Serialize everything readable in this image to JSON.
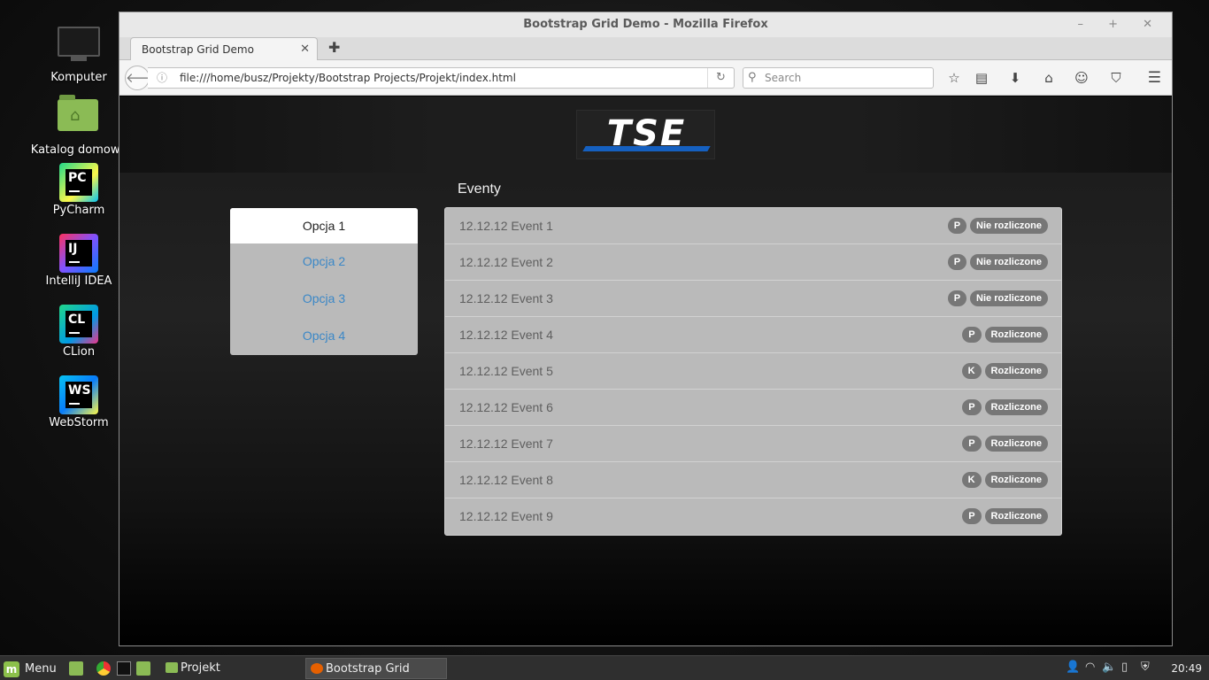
{
  "desktop": {
    "icons": [
      {
        "label": "Komputer"
      },
      {
        "label": "Katalog domowy"
      },
      {
        "label": "PyCharm",
        "abbr": "PC"
      },
      {
        "label": "IntelliJ IDEA",
        "abbr": "IJ"
      },
      {
        "label": "CLion",
        "abbr": "CL"
      },
      {
        "label": "WebStorm",
        "abbr": "WS"
      }
    ]
  },
  "window": {
    "title": "Bootstrap Grid Demo - Mozilla Firefox",
    "controls": "–  +  ✕",
    "tab": {
      "label": "Bootstrap Grid Demo",
      "close": "✕"
    },
    "newtab": "✚",
    "url": "file:///home/busz/Projekty/Bootstrap Projects/Projekt/index.html",
    "search_placeholder": "Search"
  },
  "page": {
    "logo": "TSE",
    "events_title": "Eventy",
    "nav": [
      {
        "label": "Opcja 1",
        "active": true
      },
      {
        "label": "Opcja 2",
        "active": false
      },
      {
        "label": "Opcja 3",
        "active": false
      },
      {
        "label": "Opcja 4",
        "active": false
      }
    ],
    "events": [
      {
        "label": "12.12.12 Event 1",
        "type": "P",
        "status": "Nie rozliczone"
      },
      {
        "label": "12.12.12 Event 2",
        "type": "P",
        "status": "Nie rozliczone"
      },
      {
        "label": "12.12.12 Event 3",
        "type": "P",
        "status": "Nie rozliczone"
      },
      {
        "label": "12.12.12 Event 4",
        "type": "P",
        "status": "Rozliczone"
      },
      {
        "label": "12.12.12 Event 5",
        "type": "K",
        "status": "Rozliczone"
      },
      {
        "label": "12.12.12 Event 6",
        "type": "P",
        "status": "Rozliczone"
      },
      {
        "label": "12.12.12 Event 7",
        "type": "P",
        "status": "Rozliczone"
      },
      {
        "label": "12.12.12 Event 8",
        "type": "K",
        "status": "Rozliczone"
      },
      {
        "label": "12.12.12 Event 9",
        "type": "P",
        "status": "Rozliczone"
      }
    ]
  },
  "taskbar": {
    "menu_label": "Menu",
    "tasks": [
      {
        "label": "Projekt"
      },
      {
        "label": "Bootstrap Grid Dem..."
      }
    ],
    "clock": "20:49"
  },
  "colors": {
    "link": "#3a87c7",
    "badge": "#777777",
    "list_bg": "#bababa"
  }
}
